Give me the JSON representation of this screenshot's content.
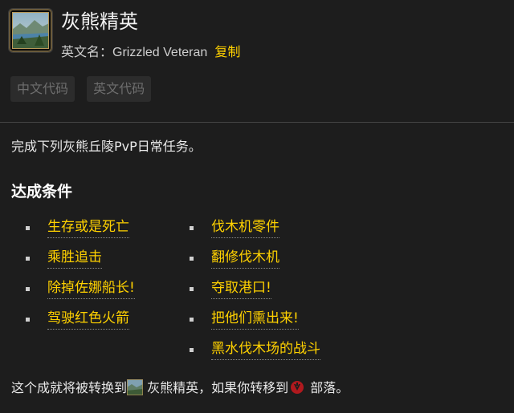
{
  "achievement": {
    "title": "灰熊精英",
    "en_label": "英文名：",
    "en_name": "Grizzled Veteran",
    "copy_label": "复制",
    "icon": "landscape-achievement-icon"
  },
  "code_buttons": [
    "中文代码",
    "英文代码"
  ],
  "description": "完成下列灰熊丘陵PvP日常任务。",
  "criteria_title": "达成条件",
  "criteria": {
    "col1": [
      "生存或是死亡",
      "乘胜追击",
      "除掉佐娜船长!",
      "驾驶红色火箭"
    ],
    "col2": [
      "伐木机零件",
      "翻修伐木机",
      "夺取港口!",
      "把他们熏出来!",
      "黑水伐木场的战斗"
    ]
  },
  "footer": {
    "prefix": "这个成就将被转换到",
    "link": "灰熊精英",
    "middle": "，如果你转移到",
    "faction": "部落",
    "suffix": "。",
    "faction_icon": "horde-icon"
  },
  "colors": {
    "background": "#1d1d1d",
    "link": "#ffd100",
    "text": "#e8e8e8",
    "horde_red": "#b0191e"
  }
}
